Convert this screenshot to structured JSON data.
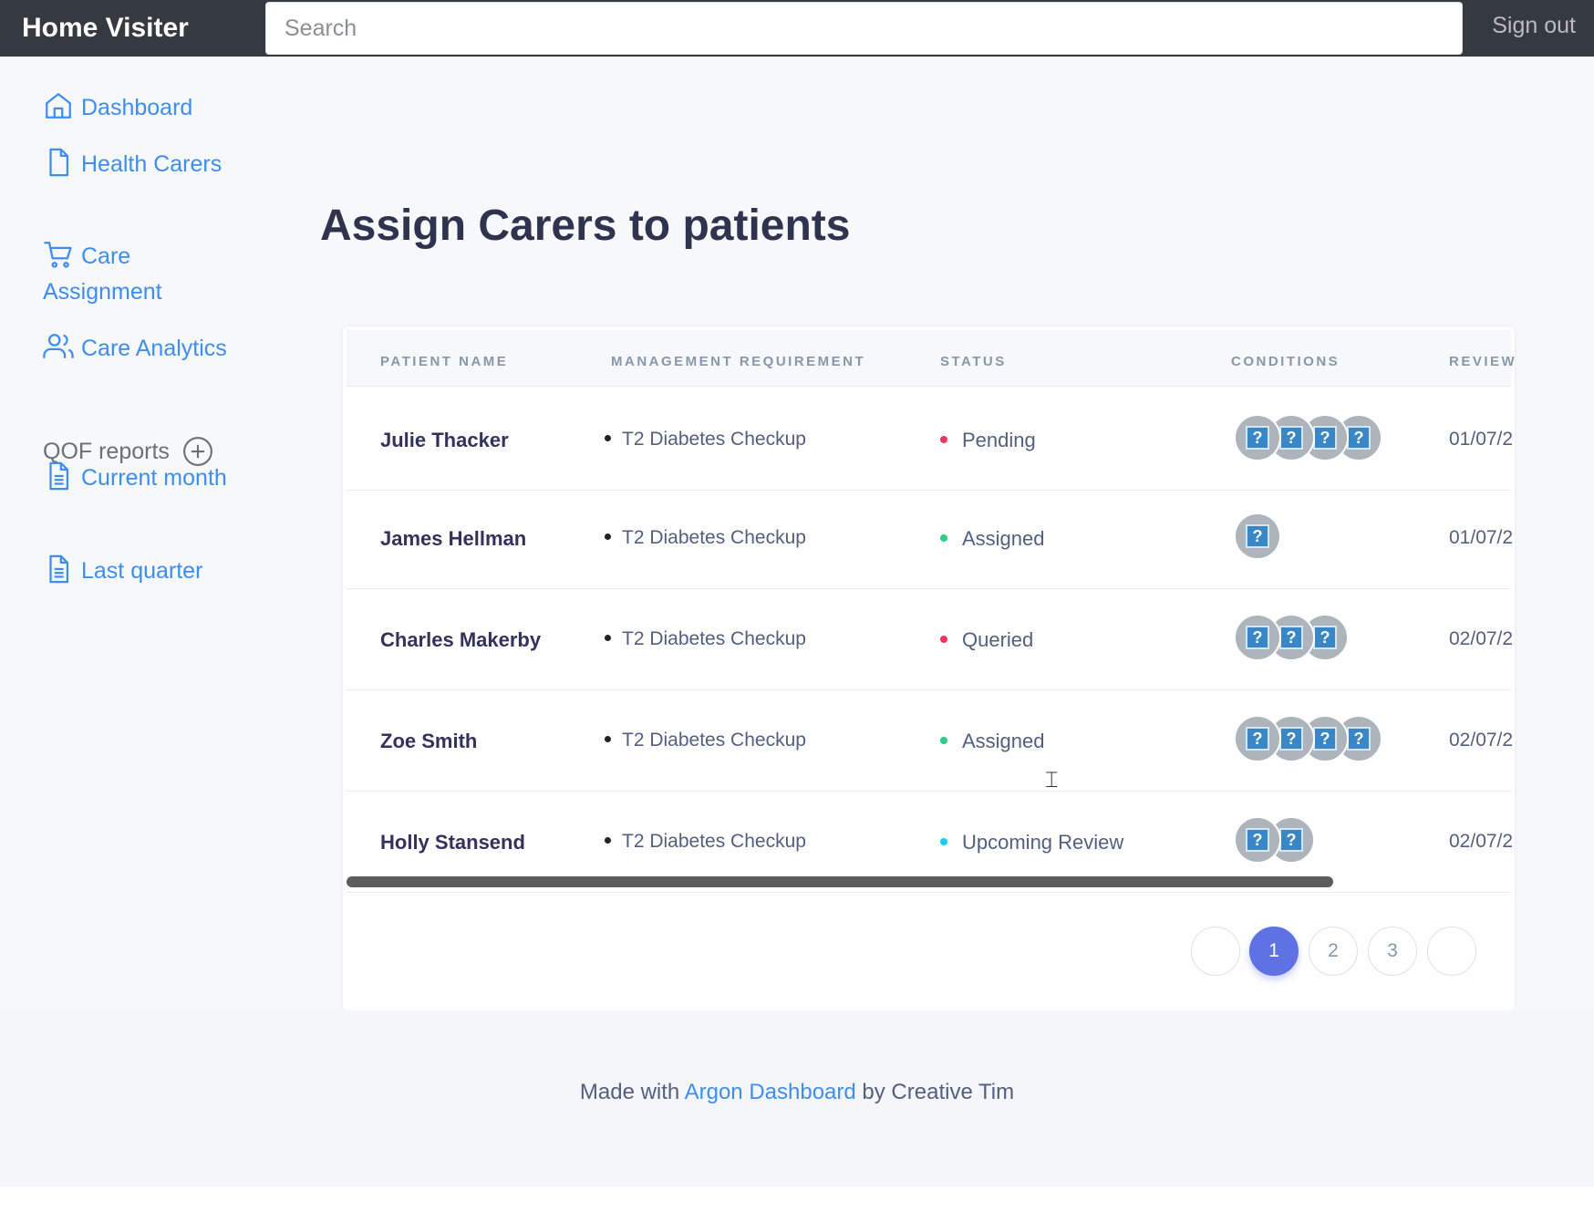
{
  "navbar": {
    "brand": "Home Visiter",
    "search_placeholder": "Search",
    "signout": "Sign out"
  },
  "sidebar": {
    "items": [
      {
        "label": "Dashboard",
        "icon": "home-icon"
      },
      {
        "label": "Health Carers",
        "icon": "file-icon"
      },
      {
        "label": "Care Assignment",
        "icon": "cart-icon"
      },
      {
        "label": "Care Analytics",
        "icon": "users-icon"
      }
    ],
    "section": "QOF reports",
    "reports": [
      {
        "label": "Current month",
        "icon": "document-icon"
      },
      {
        "label": "Last quarter",
        "icon": "document-icon"
      }
    ]
  },
  "page": {
    "title": "Assign Carers to patients"
  },
  "table": {
    "headers": [
      "PATIENT NAME",
      "MANAGEMENT REQUIREMENT",
      "STATUS",
      "CONDITIONS",
      "REVIEW"
    ],
    "rows": [
      {
        "name": "Julie Thacker",
        "requirement": "T2 Diabetes Checkup",
        "status": "Pending",
        "status_color": "#f5365c",
        "conditions": 4,
        "date": "01/07/2"
      },
      {
        "name": "James Hellman",
        "requirement": "T2 Diabetes Checkup",
        "status": "Assigned",
        "status_color": "#2dce89",
        "conditions": 1,
        "date": "01/07/2"
      },
      {
        "name": "Charles Makerby",
        "requirement": "T2 Diabetes Checkup",
        "status": "Queried",
        "status_color": "#f5365c",
        "conditions": 3,
        "date": "02/07/2"
      },
      {
        "name": "Zoe Smith",
        "requirement": "T2 Diabetes Checkup",
        "status": "Assigned",
        "status_color": "#2dce89",
        "conditions": 4,
        "date": "02/07/2"
      },
      {
        "name": "Holly Stansend",
        "requirement": "T2 Diabetes Checkup",
        "status": "Upcoming Review",
        "status_color": "#11cdef",
        "conditions": 2,
        "date": "02/07/2"
      }
    ],
    "condition_glyph": "?"
  },
  "pagination": {
    "pages": [
      "",
      "1",
      "2",
      "3",
      ""
    ],
    "active": "1"
  },
  "footer": {
    "prefix": "Made with",
    "link": "Argon Dashboard",
    "suffix": "by Creative Tim"
  },
  "colors": {
    "accent": "#5e72e4",
    "link": "#3e8ef1",
    "navbar": "#343a40"
  }
}
